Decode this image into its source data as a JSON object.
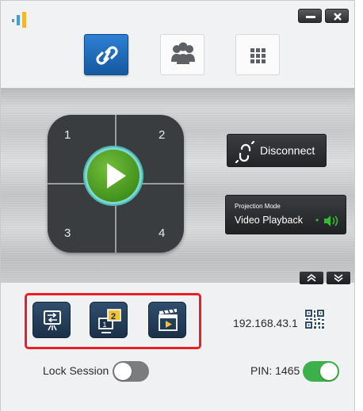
{
  "window": {
    "logo_icon": "signal-bars-icon",
    "minimize_icon": "minimize-icon",
    "close_icon": "close-icon"
  },
  "tabs": [
    {
      "icon": "link-icon",
      "state": "active"
    },
    {
      "icon": "group-users-icon",
      "state": "inactive"
    },
    {
      "icon": "grid-icon",
      "state": "inactive"
    }
  ],
  "quad": {
    "numbers": [
      "1",
      "2",
      "3",
      "4"
    ],
    "play_icon": "play-icon"
  },
  "disconnect": {
    "label": "Disconnect",
    "icon": "broken-link-icon"
  },
  "projection": {
    "title": "Projection Mode",
    "value": "Video Playback",
    "separator": "•",
    "icon": "speaker-icon"
  },
  "panel_controls": {
    "expand_up_icon": "double-chevron-up-icon",
    "expand_down_icon": "double-chevron-down-icon"
  },
  "tools": [
    {
      "icon": "screen-swap-icon"
    },
    {
      "icon": "dual-monitor-icon"
    },
    {
      "icon": "clapperboard-play-icon"
    }
  ],
  "network": {
    "ip": "192.168.43.1",
    "qr_icon": "qr-code-icon"
  },
  "session": {
    "lock_label": "Lock Session",
    "lock_on": false,
    "pin_label": "PIN: 1465",
    "pin_on": true
  },
  "colors": {
    "active_tab": "#1f6bbd",
    "play_green": "#4fa223",
    "toggle_on": "#3cb04a",
    "toggle_off": "#7a7c7e",
    "highlight_box": "#ee1c25"
  }
}
